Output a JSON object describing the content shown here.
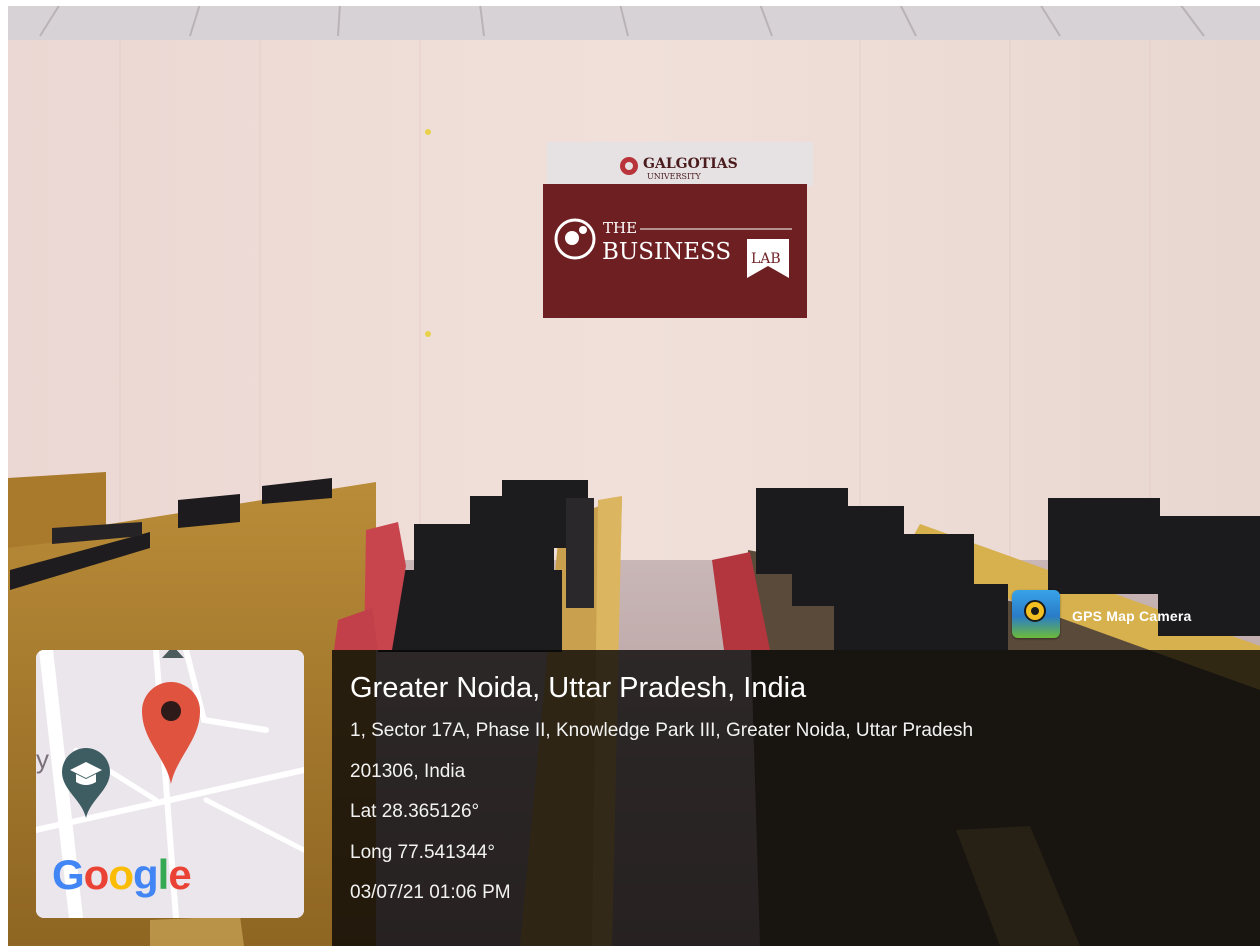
{
  "photo": {
    "sign": {
      "university": "GALGOTIAS",
      "university_sub": "UNIVERSITY",
      "line_the": "THE",
      "line_business": "BUSINESS",
      "badge_lab": "LAB"
    }
  },
  "gps_app": {
    "icon": "gps-map-camera-icon",
    "name": "GPS Map Camera"
  },
  "map": {
    "logo": "Google",
    "edge_label": "y",
    "pin_icon": "map-pin-icon",
    "place_icon": "graduation-cap-icon",
    "colors": {
      "pin": "#e0533f",
      "place": "#3d5d62",
      "map_bg": "#ebe6ec"
    }
  },
  "location": {
    "title": "Greater Noida, Uttar Pradesh, India",
    "address_line1": "1, Sector 17A, Phase II, Knowledge Park III, Greater Noida, Uttar Pradesh",
    "address_line2": "201306, India",
    "latitude": "Lat 28.365126°",
    "longitude": "Long 77.541344°",
    "timestamp": "03/07/21 01:06 PM"
  }
}
